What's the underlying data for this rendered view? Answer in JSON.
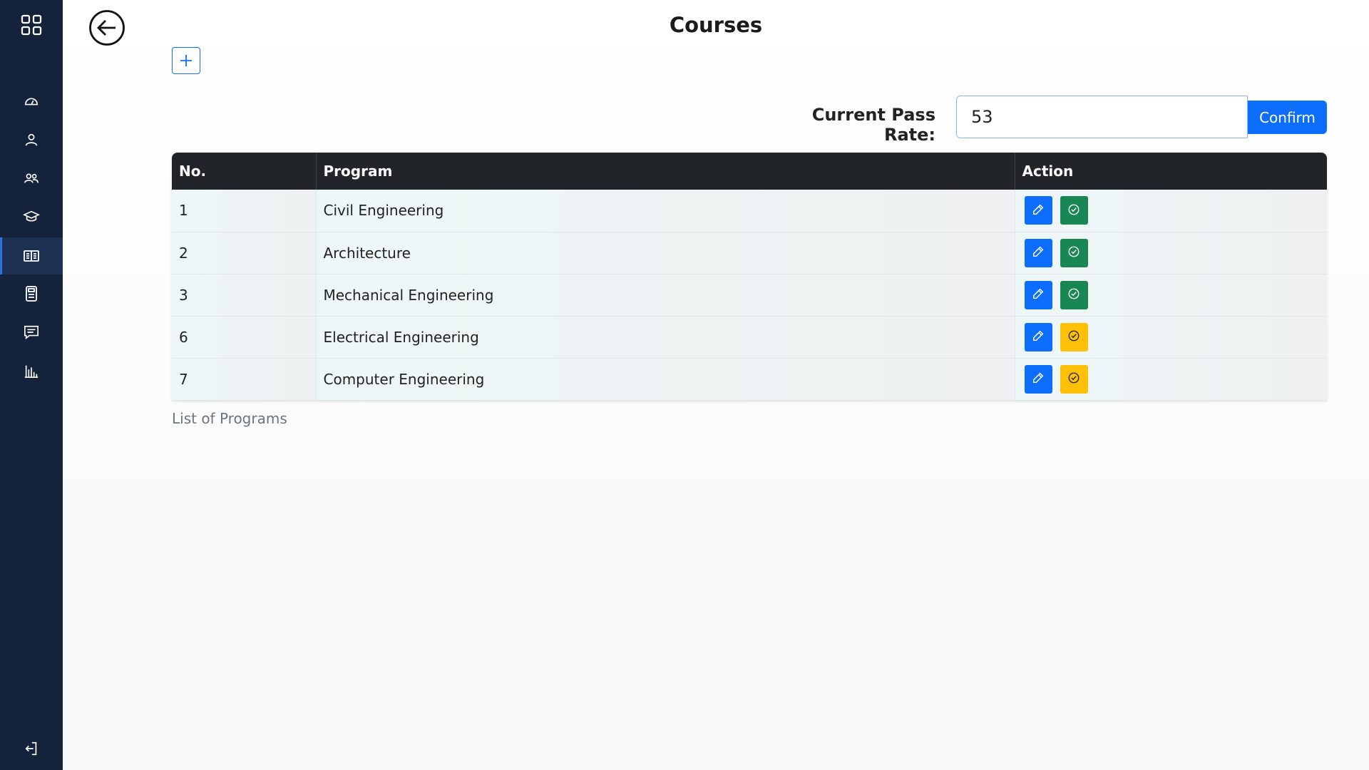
{
  "page": {
    "title": "Courses",
    "pass_rate_label": "Current Pass Rate:",
    "pass_rate_value": "53",
    "confirm_label": "Confirm",
    "caption": "List of Programs"
  },
  "sidebar": {
    "items": [
      {
        "name": "dashboard",
        "icon": "gauge-icon"
      },
      {
        "name": "user",
        "icon": "person-icon"
      },
      {
        "name": "users",
        "icon": "people-icon"
      },
      {
        "name": "graduation",
        "icon": "mortarboard-icon"
      },
      {
        "name": "courses",
        "icon": "book-icon",
        "active": true
      },
      {
        "name": "calculator",
        "icon": "calculator-icon"
      },
      {
        "name": "messages",
        "icon": "chat-icon"
      },
      {
        "name": "reports",
        "icon": "bar-chart-icon"
      }
    ]
  },
  "table": {
    "headers": [
      "No.",
      "Program",
      "Action"
    ],
    "rows": [
      {
        "no": "1",
        "program": "Civil Engineering",
        "status": "green"
      },
      {
        "no": "2",
        "program": "Architecture",
        "status": "green"
      },
      {
        "no": "3",
        "program": "Mechanical Engineering",
        "status": "green"
      },
      {
        "no": "6",
        "program": "Electrical Engineering",
        "status": "yellow"
      },
      {
        "no": "7",
        "program": "Computer Engineering",
        "status": "yellow"
      }
    ]
  },
  "colors": {
    "sidebar_bg": "#14233b",
    "primary": "#0d6efd",
    "success": "#198754",
    "warning": "#ffc107",
    "table_header": "#212529"
  }
}
